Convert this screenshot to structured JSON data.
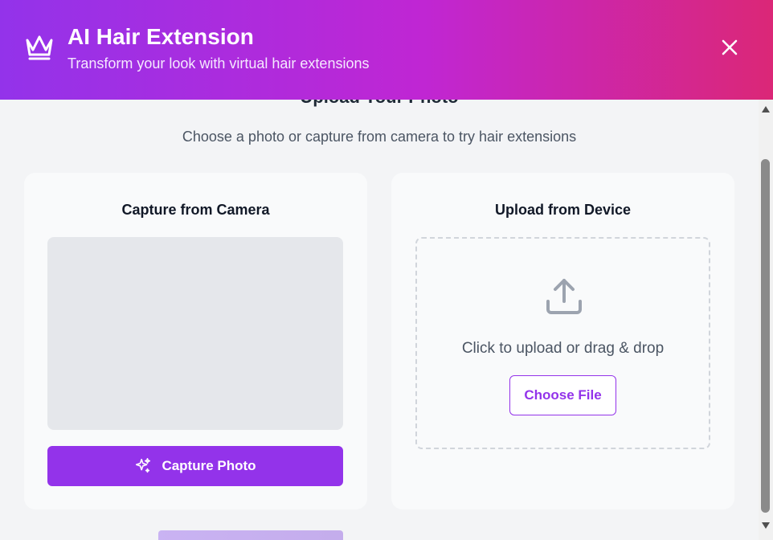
{
  "header": {
    "title": "AI Hair Extension",
    "subtitle": "Transform your look with virtual hair extensions",
    "icon": "crown-icon",
    "close_icon": "close-icon"
  },
  "section": {
    "title": "Upload Your Photo",
    "subtitle": "Choose a photo or capture from camera to try hair extensions"
  },
  "camera_card": {
    "title": "Capture from Camera",
    "button_label": "Capture Photo",
    "button_icon": "sparkles-icon"
  },
  "upload_card": {
    "title": "Upload from Device",
    "drop_text": "Click to upload or drag & drop",
    "button_label": "Choose File",
    "icon": "upload-icon"
  },
  "colors": {
    "accent": "#9333ea",
    "header_gradient_start": "#9333ea",
    "header_gradient_end": "#db2777",
    "card_bg": "#f9fafb",
    "preview_bg": "#e5e7eb"
  }
}
